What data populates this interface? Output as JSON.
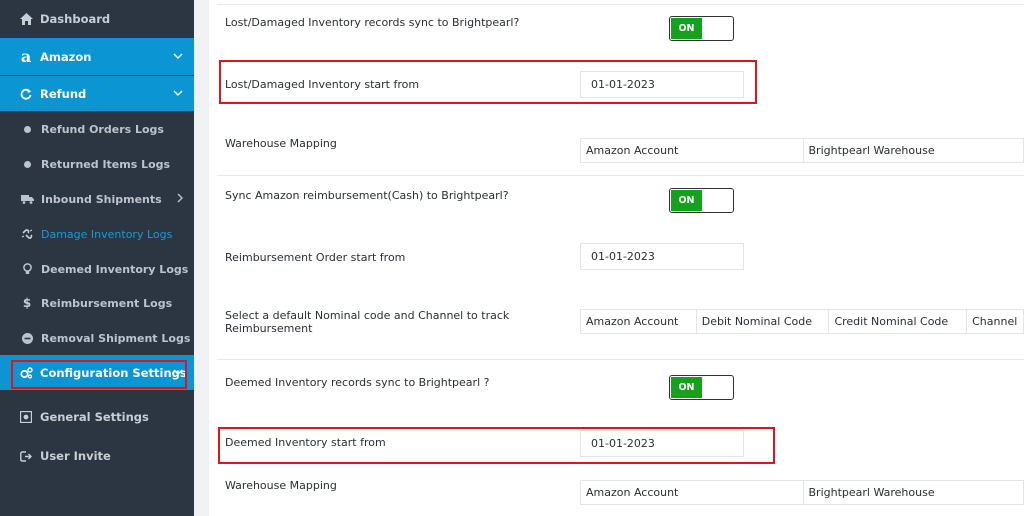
{
  "sidebar": {
    "items": [
      {
        "label": "Dashboard",
        "icon": "home-icon"
      },
      {
        "label": "Amazon",
        "icon": "amazon-icon"
      },
      {
        "label": "Refund",
        "icon": "refresh-icon"
      },
      {
        "label": "Refund Orders Logs",
        "icon": "dot-icon"
      },
      {
        "label": "Returned Items Logs",
        "icon": "dot-icon"
      },
      {
        "label": "Inbound Shipments",
        "icon": "truck-icon"
      },
      {
        "label": "Damage Inventory Logs",
        "icon": "broken-link-icon"
      },
      {
        "label": "Deemed Inventory Logs",
        "icon": "bulb-icon"
      },
      {
        "label": "Reimbursement Logs",
        "icon": "dollar-icon"
      },
      {
        "label": "Removal Shipment Logs",
        "icon": "minus-circle-icon"
      },
      {
        "label": "Configuration Settings",
        "icon": "cogs-icon"
      },
      {
        "label": "General Settings",
        "icon": "settings-box-icon"
      },
      {
        "label": "User Invite",
        "icon": "user-invite-icon"
      }
    ]
  },
  "main": {
    "lost_sync_label": "Lost/Damaged Inventory records sync to Brightpearl?",
    "lost_sync_toggle": "ON",
    "lost_start_label": "Lost/Damaged Inventory start from",
    "lost_start_value": "01-01-2023",
    "warehouse_mapping_label_1": "Warehouse Mapping",
    "warehouse_table_1": [
      "Amazon Account",
      "Brightpearl Warehouse"
    ],
    "reimb_sync_label": "Sync Amazon reimbursement(Cash) to Brightpearl?",
    "reimb_sync_toggle": "ON",
    "reimb_start_label": "Reimbursement Order start from",
    "reimb_start_value": "01-01-2023",
    "nominal_label": "Select a default Nominal code and Channel to track Reimbursement",
    "nominal_table": [
      "Amazon Account",
      "Debit Nominal Code",
      "Credit Nominal Code",
      "Channel"
    ],
    "deemed_sync_label": "Deemed Inventory records sync to Brightpearl ?",
    "deemed_sync_toggle": "ON",
    "deemed_start_label": "Deemed Inventory start from",
    "deemed_start_value": "01-01-2023",
    "warehouse_mapping_label_2": "Warehouse Mapping",
    "warehouse_table_2": [
      "Amazon Account",
      "Brightpearl Warehouse"
    ]
  },
  "colors": {
    "sidebar_bg": "#2c3542",
    "active_blue": "#0c95d3",
    "toggle_green": "#14a21d",
    "highlight_red": "#e0141e"
  }
}
